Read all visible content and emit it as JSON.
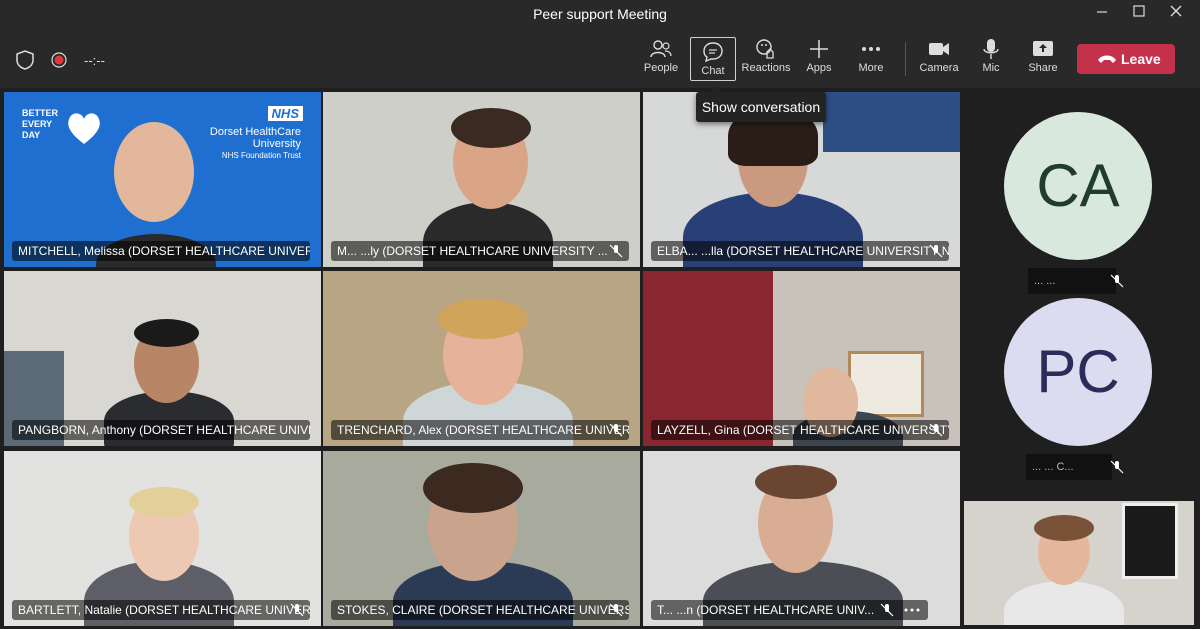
{
  "window": {
    "title": "Peer support Meeting"
  },
  "status": {
    "timer": "--:--"
  },
  "toolbar": {
    "people": "People",
    "chat": "Chat",
    "reactions": "Reactions",
    "apps": "Apps",
    "more": "More",
    "camera": "Camera",
    "mic": "Mic",
    "share": "Share",
    "leave": "Leave"
  },
  "tooltip": "Show conversation",
  "tiles": [
    {
      "name": "MITCHELL, Melissa (DORSET HEALTHCARE UNIVERSITY ...",
      "bg": "#1f6fd1"
    },
    {
      "name": "M... ...ly (DORSET HEALTHCARE UNIVERSITY ...",
      "bg": "#cfcfca"
    },
    {
      "name": "ELBA... ...lla (DORSET HEALTHCARE UNIVERSITY NH...",
      "bg": "#d7d8d8"
    },
    {
      "name": "PANGBORN, Anthony (DORSET HEALTHCARE UNIVERSI...",
      "bg": "#d9d7d2"
    },
    {
      "name": "TRENCHARD, Alex (DORSET HEALTHCARE UNIVERSI...",
      "bg": "#b7a583"
    },
    {
      "name": "LAYZELL, Gina (DORSET HEALTHCARE UNIVERSITY ...",
      "bg": "#c8c2ba"
    },
    {
      "name": "BARTLETT, Natalie (DORSET HEALTHCARE UNIVERSI...",
      "bg": "#e2e2e0"
    },
    {
      "name": "STOKES, CLAIRE (DORSET HEALTHCARE UNIVERSITY...",
      "bg": "#a7aa9c"
    },
    {
      "name": "T... ...n (DORSET HEALTHCARE UNIV...",
      "bg": "#dcdcdc"
    }
  ],
  "banner": {
    "line1": "Dorset HealthCare",
    "line2": "University",
    "line3": "NHS Foundation Trust",
    "nhs": "NHS",
    "slogan": "BETTER EVERY DAY"
  },
  "side": [
    {
      "initials": "CA",
      "tag": "... ...",
      "color": "#d8e8dc"
    },
    {
      "initials": "PC",
      "tag": "... ... C...",
      "color": "#dcdcf0"
    }
  ]
}
